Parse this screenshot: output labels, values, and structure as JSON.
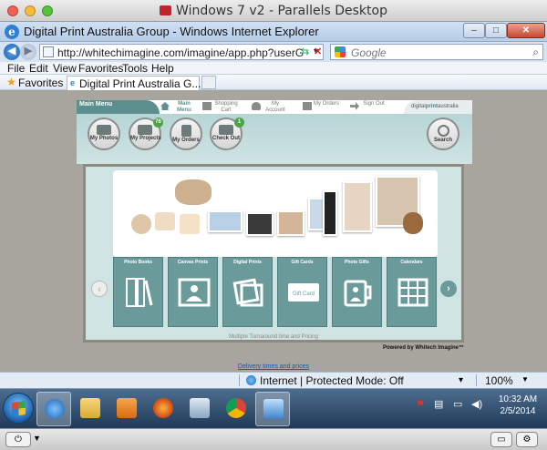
{
  "mac_window": {
    "title": "Windows 7 v2 - Parallels Desktop"
  },
  "ie": {
    "title": "Digital Print Australia Group - Windows Internet Explorer",
    "address": "http://whitechimagine.com/imagine/app.php?userGrou",
    "search_placeholder": "Google",
    "menu": [
      "File",
      "Edit",
      "View",
      "Favorites",
      "Tools",
      "Help"
    ],
    "favorites_label": "Favorites",
    "tab_title": "Digital Print Australia G..."
  },
  "site": {
    "main_menu": "Main Menu",
    "nav": [
      {
        "label": "Main Menu",
        "icon": "home-icon"
      },
      {
        "label": "Shopping Cart",
        "icon": "cart-icon"
      },
      {
        "label": "My Account",
        "icon": "account-icon"
      },
      {
        "label": "My Orders",
        "icon": "orders-icon"
      },
      {
        "label": "Sign Out",
        "icon": "sign-out-icon"
      }
    ],
    "brand": {
      "prefix": "digital",
      "bold": "print",
      "suffix": "australia"
    },
    "circle_buttons": [
      {
        "label": "My Photos",
        "icon": "photos-icon",
        "badge": ""
      },
      {
        "label": "My Projects",
        "icon": "projects-icon",
        "badge": "76"
      },
      {
        "label": "My Orders",
        "icon": "clipboard-icon",
        "badge": ""
      },
      {
        "label": "Check Out",
        "icon": "cart-icon",
        "badge": "1"
      },
      {
        "label": "Search",
        "icon": "search-icon",
        "badge": ""
      }
    ],
    "categories": [
      {
        "label": "Photo Books",
        "icon": "book-icon"
      },
      {
        "label": "Canvas Prints",
        "icon": "canvas-icon"
      },
      {
        "label": "Digital Prints",
        "icon": "prints-icon"
      },
      {
        "label": "Gift Cards",
        "icon": "gift-card-icon",
        "card_text": "Gift Card"
      },
      {
        "label": "Photo Gifts",
        "icon": "mug-icon"
      },
      {
        "label": "Calendars",
        "icon": "calendar-icon"
      }
    ],
    "faint_text": "Multiple Turnaround time and Pricing",
    "powered_by": "Powered by Whitech Imagine™",
    "delivery_link": "Delivery times and prices"
  },
  "status_bar": {
    "zone": "Internet | Protected Mode: Off",
    "zoom": "100%"
  },
  "taskbar": {
    "time": "10:32 AM",
    "date": "2/5/2014"
  }
}
